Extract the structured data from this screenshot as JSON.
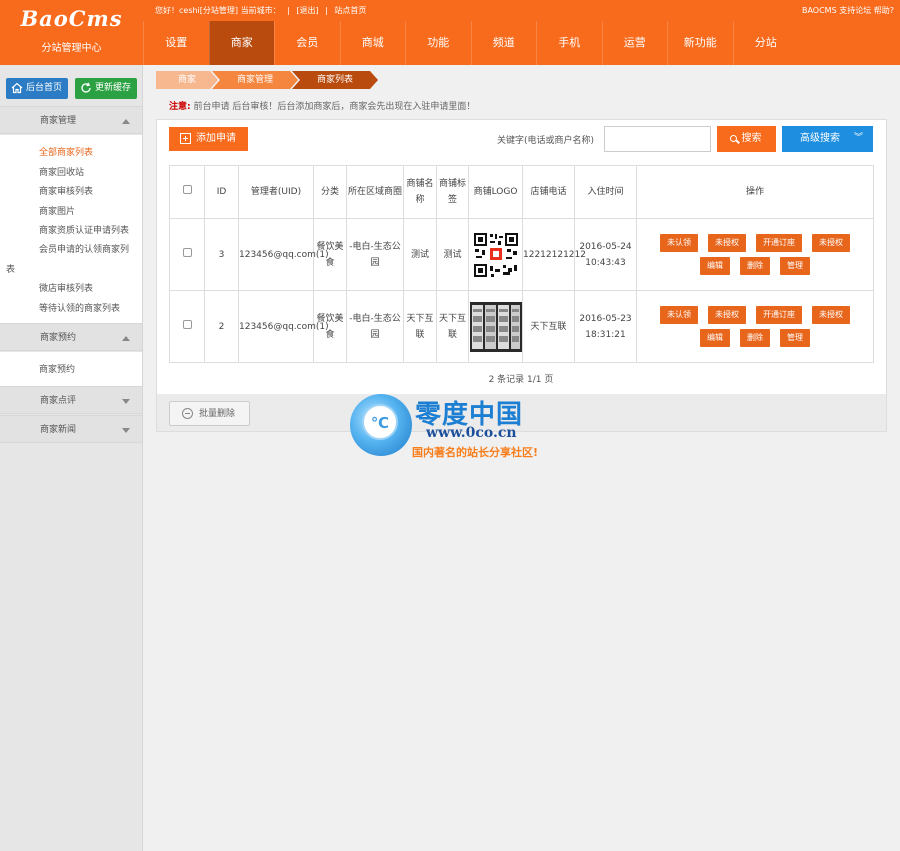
{
  "header": {
    "logo": "BaoCms",
    "logo_sub": "分站管理中心",
    "greeting": "您好！ceshi[分站管理] 当前城市：",
    "logout": "[退出]",
    "site_home": "站点首页",
    "support": "BAOCMS 支持论坛",
    "help": "帮助?"
  },
  "nav": [
    "设置",
    "商家",
    "会员",
    "商城",
    "功能",
    "频道",
    "手机",
    "运营",
    "新功能",
    "分站"
  ],
  "nav_active": 1,
  "sidebar": {
    "home_btn": "后台首页",
    "cache_btn": "更新缓存",
    "groups": [
      {
        "title": "商家管理",
        "expanded": true
      },
      {
        "title": "商家预约",
        "expanded": true
      },
      {
        "title": "商家点评",
        "expanded": false
      },
      {
        "title": "商家新闻",
        "expanded": false
      }
    ],
    "merchant_items": [
      "全部商家列表",
      "商家回收站",
      "商家审核列表",
      "商家图片",
      "商家资质认证申请列表",
      "会员申请的认领商家列",
      "表",
      "微店审核列表",
      "等待认领的商家列表"
    ],
    "booking_items": [
      "商家预约"
    ]
  },
  "breadcrumb": [
    "商家",
    "商家管理",
    "商家列表"
  ],
  "notice": {
    "label": "注意:",
    "text": "前台申请 后台审核！后台添加商家后，商家会先出现在入驻申请里面！"
  },
  "toolbar": {
    "add_label": "添加申请",
    "keyword_label": "关键字(电话或商户名称)",
    "keyword_value": "",
    "search_label": "搜索",
    "advanced_label": "高级搜索"
  },
  "table": {
    "headers": [
      "",
      "ID",
      "管理者(UID)",
      "分类",
      "所在区域商圈",
      "商铺名称",
      "商铺标签",
      "商铺LOGO",
      "店铺电话",
      "入住时间",
      "操作"
    ],
    "rows": [
      {
        "id": "3",
        "manager": "123456@qq.com(1)",
        "category": "餐饮美食",
        "area": "-电白-生态公园",
        "name": "测试",
        "tag": "测试",
        "logo": "qr-code",
        "phone": "12212121212",
        "time": "2016-05-24 10:43:43",
        "actions": [
          "未认领",
          "未授权",
          "开通订座",
          "未授权",
          "编辑",
          "删除",
          "管理"
        ]
      },
      {
        "id": "2",
        "manager": "123456@qq.com(1)",
        "category": "餐饮美食",
        "area": "-电白-生态公园",
        "name": "天下互联",
        "tag": "天下互联",
        "logo": "screenshots",
        "phone": "天下互联",
        "time": "2016-05-23 18:31:21",
        "actions": [
          "未认领",
          "未授权",
          "开通订座",
          "未授权",
          "编辑",
          "删除",
          "管理"
        ]
      }
    ]
  },
  "pagination": "2 条记录 1/1 页",
  "bulk_delete": "批量删除",
  "watermark": {
    "badge": "℃",
    "title": "零度中国",
    "url": "www.0co.cn",
    "slogan": "国内著名的站长分享社区!"
  },
  "colors": {
    "brand_orange": "#f86a1c",
    "nav_active": "#b94b0e",
    "blue": "#1e8fe0",
    "green": "#2ca144"
  }
}
